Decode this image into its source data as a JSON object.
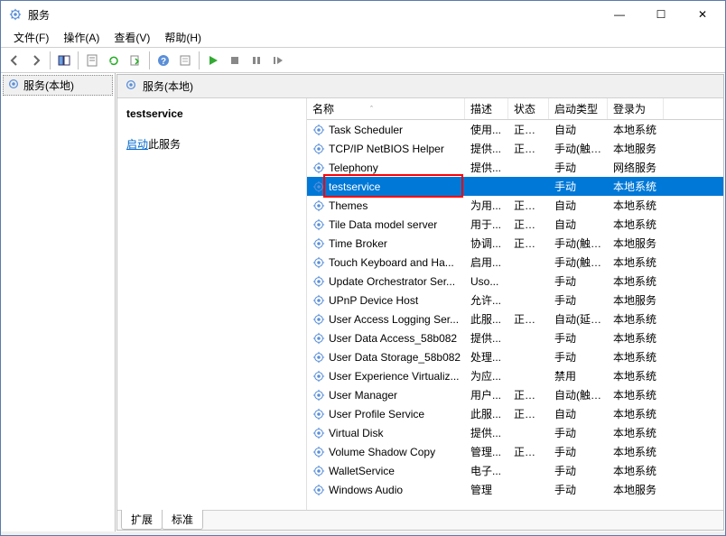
{
  "window": {
    "title": "服务",
    "minimize": "—",
    "maximize": "☐",
    "close": "✕"
  },
  "menu": {
    "file": "文件(F)",
    "action": "操作(A)",
    "view": "查看(V)",
    "help": "帮助(H)"
  },
  "tree": {
    "root": "服务(本地)"
  },
  "content_header": "服务(本地)",
  "detail": {
    "selected_name": "testservice",
    "start_link": "启动",
    "start_suffix": "此服务"
  },
  "columns": {
    "name": "名称",
    "desc": "描述",
    "status": "状态",
    "startup": "启动类型",
    "logon": "登录为"
  },
  "services": [
    {
      "name": "Task Scheduler",
      "desc": "使用...",
      "status": "正在...",
      "startup": "自动",
      "logon": "本地系统"
    },
    {
      "name": "TCP/IP NetBIOS Helper",
      "desc": "提供...",
      "status": "正在...",
      "startup": "手动(触发...",
      "logon": "本地服务"
    },
    {
      "name": "Telephony",
      "desc": "提供...",
      "status": "",
      "startup": "手动",
      "logon": "网络服务"
    },
    {
      "name": "testservice",
      "desc": "",
      "status": "",
      "startup": "手动",
      "logon": "本地系统",
      "selected": true
    },
    {
      "name": "Themes",
      "desc": "为用...",
      "status": "正在...",
      "startup": "自动",
      "logon": "本地系统"
    },
    {
      "name": "Tile Data model server",
      "desc": "用于...",
      "status": "正在...",
      "startup": "自动",
      "logon": "本地系统"
    },
    {
      "name": "Time Broker",
      "desc": "协调...",
      "status": "正在...",
      "startup": "手动(触发...",
      "logon": "本地服务"
    },
    {
      "name": "Touch Keyboard and Ha...",
      "desc": "启用...",
      "status": "",
      "startup": "手动(触发...",
      "logon": "本地系统"
    },
    {
      "name": "Update Orchestrator Ser...",
      "desc": "Uso...",
      "status": "",
      "startup": "手动",
      "logon": "本地系统"
    },
    {
      "name": "UPnP Device Host",
      "desc": "允许...",
      "status": "",
      "startup": "手动",
      "logon": "本地服务"
    },
    {
      "name": "User Access Logging Ser...",
      "desc": "此服...",
      "status": "正在...",
      "startup": "自动(延迟...",
      "logon": "本地系统"
    },
    {
      "name": "User Data Access_58b082",
      "desc": "提供...",
      "status": "",
      "startup": "手动",
      "logon": "本地系统"
    },
    {
      "name": "User Data Storage_58b082",
      "desc": "处理...",
      "status": "",
      "startup": "手动",
      "logon": "本地系统"
    },
    {
      "name": "User Experience Virtualiz...",
      "desc": "为应...",
      "status": "",
      "startup": "禁用",
      "logon": "本地系统"
    },
    {
      "name": "User Manager",
      "desc": "用户...",
      "status": "正在...",
      "startup": "自动(触发...",
      "logon": "本地系统"
    },
    {
      "name": "User Profile Service",
      "desc": "此服...",
      "status": "正在...",
      "startup": "自动",
      "logon": "本地系统"
    },
    {
      "name": "Virtual Disk",
      "desc": "提供...",
      "status": "",
      "startup": "手动",
      "logon": "本地系统"
    },
    {
      "name": "Volume Shadow Copy",
      "desc": "管理...",
      "status": "正在...",
      "startup": "手动",
      "logon": "本地系统"
    },
    {
      "name": "WalletService",
      "desc": "电子...",
      "status": "",
      "startup": "手动",
      "logon": "本地系统"
    },
    {
      "name": "Windows Audio",
      "desc": "管理",
      "status": "",
      "startup": "手动",
      "logon": "本地服务"
    }
  ],
  "tabs": {
    "extended": "扩展",
    "standard": "标准"
  }
}
